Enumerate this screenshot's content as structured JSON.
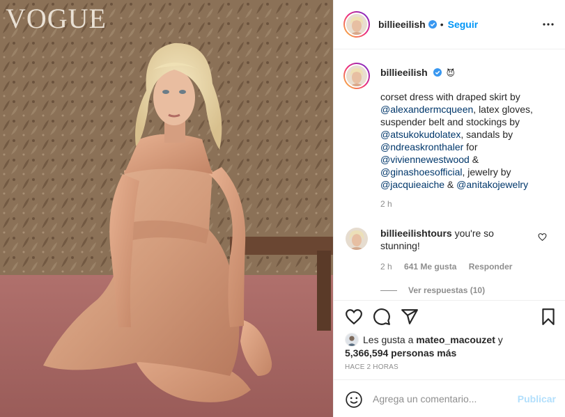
{
  "photo": {
    "watermark": "VOGUE"
  },
  "post": {
    "username": "billieeilish",
    "follow_label": "Seguir",
    "dot": "•"
  },
  "caption": {
    "username": "billieeilish",
    "emoji": "😈",
    "parts": [
      {
        "text": "corset dress with draped skirt by ",
        "mention": false
      },
      {
        "text": "@alexandermcqueen",
        "mention": true
      },
      {
        "text": ", latex gloves, suspender belt and stockings by ",
        "mention": false
      },
      {
        "text": "@atsukokudolatex",
        "mention": true
      },
      {
        "text": ", sandals by ",
        "mention": false
      },
      {
        "text": "@ndreaskronthaler",
        "mention": true
      },
      {
        "text": " for ",
        "mention": false
      },
      {
        "text": "@viviennewestwood",
        "mention": true
      },
      {
        "text": " & ",
        "mention": false
      },
      {
        "text": "@ginashoesofficial",
        "mention": true
      },
      {
        "text": ", jewelry by ",
        "mention": false
      },
      {
        "text": "@jacquieaiche",
        "mention": true
      },
      {
        "text": " & ",
        "mention": false
      },
      {
        "text": "@anitakojewelry",
        "mention": true
      }
    ],
    "time": "2 h"
  },
  "comment": {
    "username": "billieeilishtours",
    "text": " you're so stunning!",
    "time": "2 h",
    "likes": "641 Me gusta",
    "reply": "Responder",
    "view_replies": "Ver respuestas (10)"
  },
  "likes": {
    "prefix": "Les gusta a ",
    "user": "mateo_macouzet",
    "middle": " y",
    "count": "5,366,594 personas más"
  },
  "posted": "HACE 2 HORAS",
  "comment_box": {
    "placeholder": "Agrega un comentario...",
    "publish": "Publicar"
  },
  "icons": {
    "like": "heart-icon",
    "comment": "comment-icon",
    "share": "send-icon",
    "save": "bookmark-icon",
    "options": "more-icon",
    "emoji": "smiley-icon",
    "verified": "verified-badge-icon"
  },
  "colors": {
    "link": "#0095f6",
    "mention": "#00376b",
    "muted": "#8e8e8e",
    "verified": "#3897f0",
    "publish_disabled": "#b2dffc"
  }
}
